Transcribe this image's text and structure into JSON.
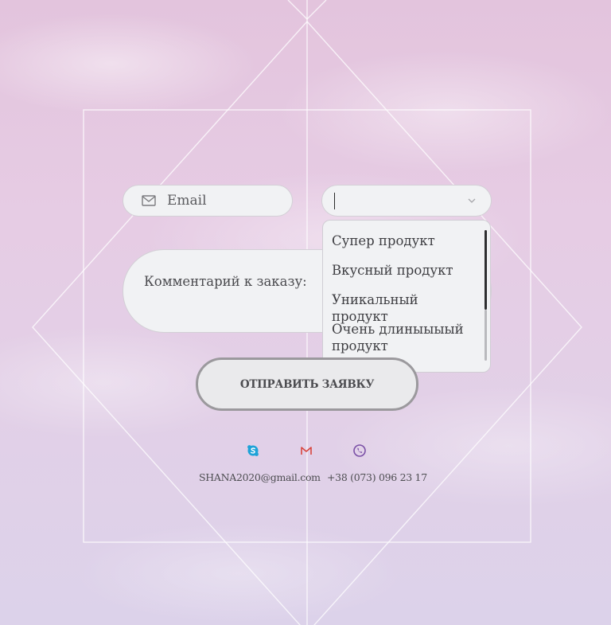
{
  "form": {
    "email_placeholder": "Email",
    "comment_placeholder": "Комментарий к заказу:",
    "submit_label": "ОТПРАВИТЬ ЗАЯВКУ",
    "product_select": {
      "options": [
        "Супер продукт",
        "Вкусный продукт",
        "Уникальный продукт",
        "Очень длиныыыый продукт"
      ]
    }
  },
  "contacts": {
    "email": "SHANA2020@gmail.com",
    "phone": "+38 (073) 096 23 17",
    "icons": [
      "skype-icon",
      "gmail-icon",
      "viber-icon"
    ]
  },
  "colors": {
    "skype": "#1ea2d8",
    "gmail": "#d8463e",
    "viber": "#7a4fa6"
  }
}
